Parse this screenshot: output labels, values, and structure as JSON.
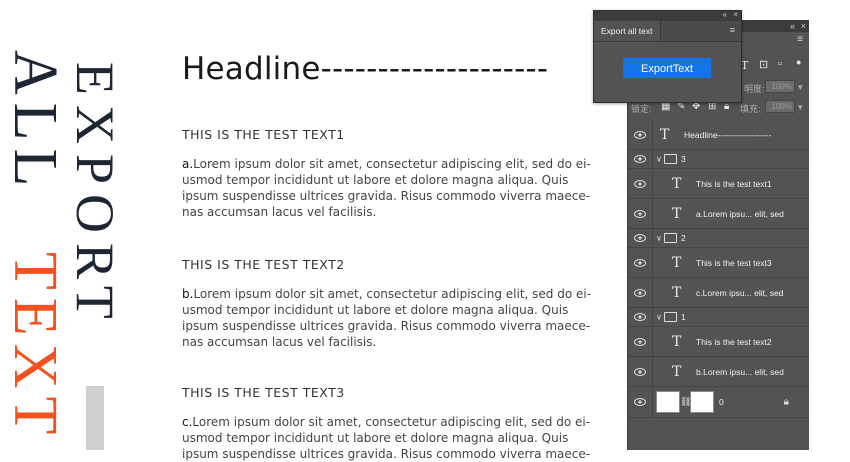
{
  "decor": {
    "vertical_all": "ALL",
    "vertical_text": "TEXT",
    "vertical_export": "EXPORT",
    "accent_color": "#f0531f",
    "dark_color": "#1e2633"
  },
  "document": {
    "headline": "Headline--------------------",
    "sections": [
      {
        "title": "THIS IS THE TEST TEXT1",
        "lead": "a.",
        "lines": [
          "Lorem ipsum dolor sit amet, consectetur adipiscing elit, sed do ei-",
          "usmod tempor incididunt ut labore et dolore magna aliqua. Quis",
          "ipsum suspendisse ultrices gravida. Risus commodo viverra maece-",
          "nas accumsan lacus vel facilisis."
        ]
      },
      {
        "title": "THIS IS THE TEST TEXT2",
        "lead": "b.",
        "lines": [
          "Lorem ipsum dolor sit amet, consectetur adipiscing elit, sed do ei-",
          "usmod tempor incididunt ut labore et dolore magna aliqua. Quis",
          "ipsum suspendisse ultrices gravida. Risus commodo viverra maece-",
          "nas accumsan lacus vel facilisis."
        ]
      },
      {
        "title": "THIS IS THE TEST TEXT3",
        "lead": "c.",
        "lines": [
          "Lorem ipsum dolor sit amet, consectetur adipiscing elit, sed do ei-",
          "usmod tempor incididunt ut labore et dolore magna aliqua. Quis",
          "ipsum suspendisse ultrices gravida. Risus commodo viverra maece-"
        ]
      }
    ]
  },
  "export_panel": {
    "tab_label": "Export all text",
    "button_label": "ExportText",
    "button_color": "#1473e6",
    "collapse_glyph": "«",
    "close_glyph": "×",
    "menu_glyph": "≡"
  },
  "layers_panel": {
    "collapse_glyph": "«",
    "close_glyph": "×",
    "menu_glyph": "≡",
    "opacity_label": "明度:",
    "opacity_value": "100%",
    "lock_label": "锁定:",
    "fill_label": "填充:",
    "fill_value": "100%",
    "layers": [
      {
        "kind": "text",
        "name": "Headline-------------------",
        "indent": 0
      },
      {
        "kind": "group",
        "name": "3"
      },
      {
        "kind": "text",
        "name": "This is the test text1",
        "indent": 1
      },
      {
        "kind": "text",
        "name": "a.Lorem ipsu... elit, sed",
        "indent": 1
      },
      {
        "kind": "group",
        "name": "2"
      },
      {
        "kind": "text",
        "name": "This is the test text3",
        "indent": 1
      },
      {
        "kind": "text",
        "name": "c.Lorem ipsu... elit, sed",
        "indent": 1
      },
      {
        "kind": "group",
        "name": "1"
      },
      {
        "kind": "text",
        "name": "This is the test text2",
        "indent": 1
      },
      {
        "kind": "text",
        "name": "b.Lorem ipsu... elit, sed",
        "indent": 1
      },
      {
        "kind": "background",
        "name": "0"
      }
    ]
  }
}
